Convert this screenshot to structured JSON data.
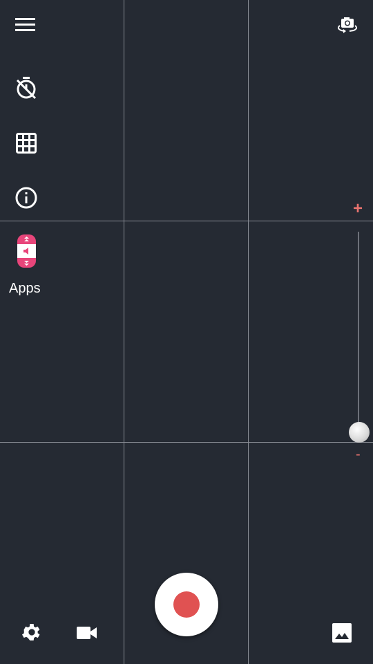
{
  "sidebar": {
    "apps_label": "Apps",
    "icons": [
      "menu-icon",
      "timer-off-icon",
      "grid-icon",
      "info-icon",
      "volume-apps-icon"
    ]
  },
  "zoom": {
    "plus": "+",
    "minus": "-",
    "level": 0
  },
  "colors": {
    "background": "#252a33",
    "record": "#e05252",
    "zoom_marks": "#e8736f",
    "apps_icon": "#e8457a"
  },
  "bottom": {
    "icons": [
      "settings-icon",
      "video-camera-icon",
      "record-button",
      "gallery-icon"
    ]
  },
  "top": {
    "icons": [
      "switch-camera-icon"
    ]
  }
}
